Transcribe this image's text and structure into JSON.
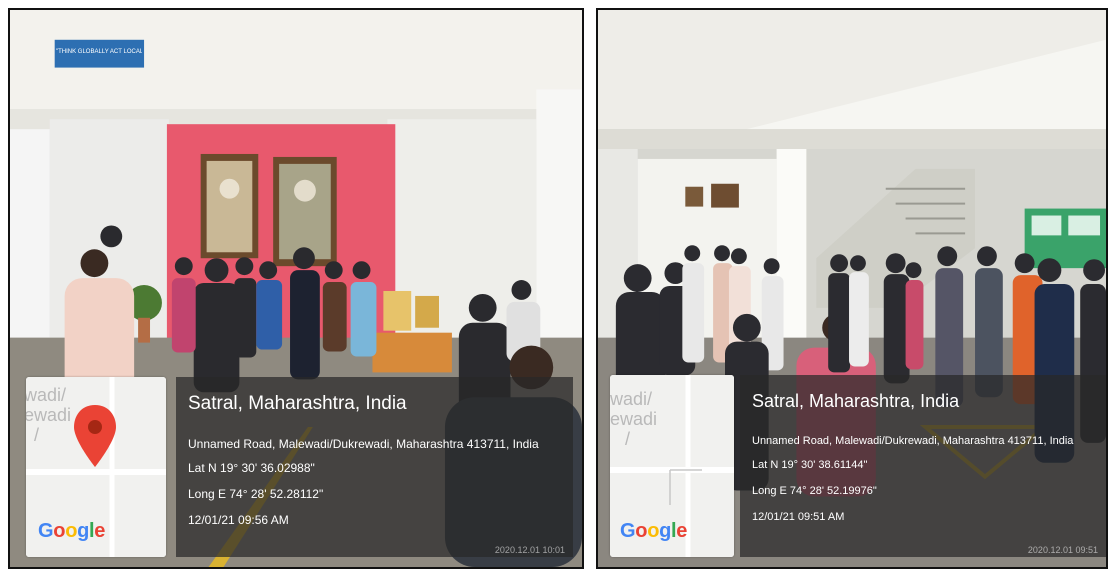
{
  "photos": [
    {
      "banner_text": "\"THINK GLOBALLY ACT LOCALLY\"",
      "map": {
        "road_text": "wadi/\newadi\n  /",
        "logo": "Google",
        "pin_color": "#ea4335"
      },
      "geo": {
        "title": "Satral, Maharashtra, India",
        "address": "Unnamed Road, Malewadi/Dukrewadi, Maharashtra 413711, India",
        "lat": "Lat N 19° 30' 36.02988\"",
        "long": "Long E 74° 28' 52.28112\"",
        "datetime": "12/01/21 09:56 AM",
        "stamp": "2020.12.01 10:01"
      }
    },
    {
      "map": {
        "road_text": "wadi/\newadi\n   /",
        "logo": "Google"
      },
      "geo": {
        "title": "Satral, Maharashtra, India",
        "address": "Unnamed Road, Malewadi/Dukrewadi, Maharashtra 413711, India",
        "lat": "Lat N 19° 30' 38.61144\"",
        "long": "Long E 74° 28' 52.19976\"",
        "datetime": "12/01/21 09:51 AM",
        "stamp": "2020.12.01 09:51"
      }
    }
  ],
  "colors": {
    "pink_wall": "#e8596d",
    "floor": "#8f8a80",
    "ceiling": "#f2f1ec",
    "overlay": "#2a2a2a"
  }
}
